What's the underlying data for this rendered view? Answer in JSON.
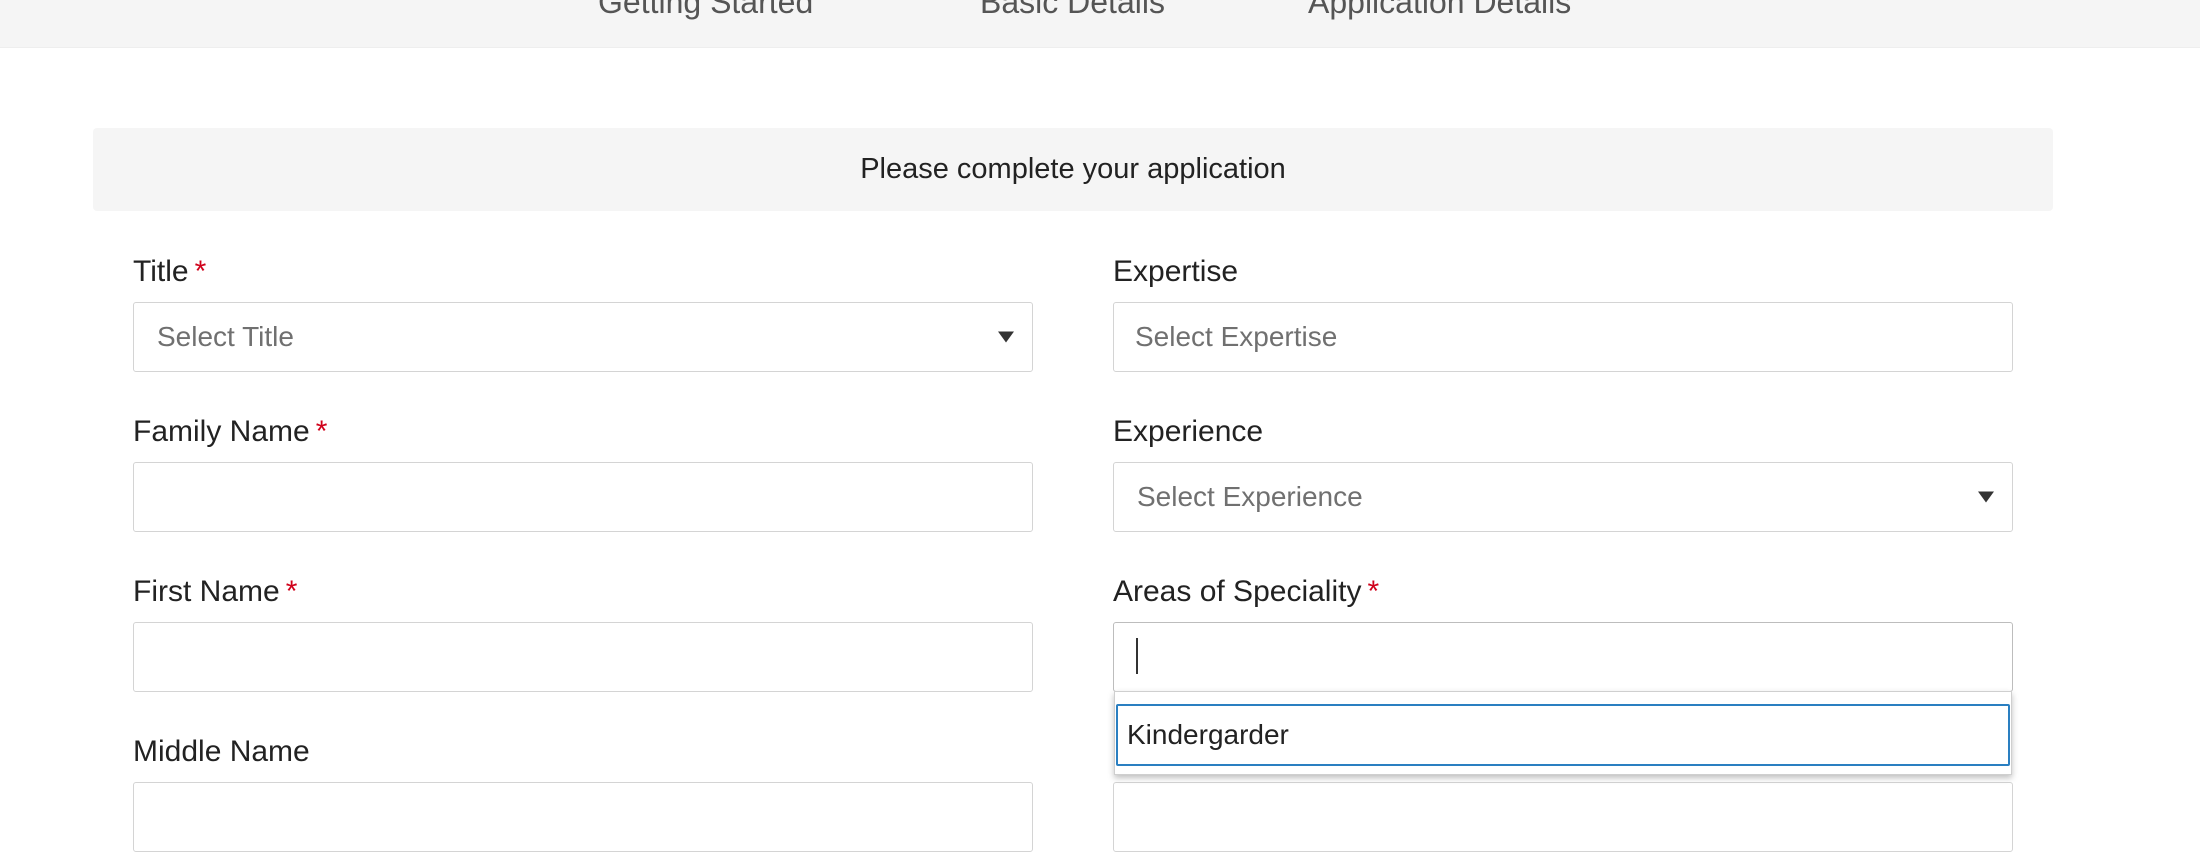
{
  "stepper": {
    "steps": [
      {
        "label": "Getting Started"
      },
      {
        "label": "Basic Details"
      },
      {
        "label": "Application Details"
      }
    ]
  },
  "banner": {
    "text": "Please complete your application"
  },
  "form": {
    "required_marker": "*",
    "title": {
      "label": "Title",
      "placeholder": "Select Title"
    },
    "family_name": {
      "label": "Family Name",
      "value": ""
    },
    "first_name": {
      "label": "First Name",
      "value": ""
    },
    "middle_name": {
      "label": "Middle Name",
      "value": ""
    },
    "expertise": {
      "label": "Expertise",
      "placeholder": "Select Expertise"
    },
    "experience": {
      "label": "Experience",
      "placeholder": "Select Experience"
    },
    "areas_of_speciality": {
      "label": "Areas of Speciality",
      "value": "",
      "options": [
        "Kindergarder"
      ]
    }
  },
  "icons": {
    "title_select": "chevron-down-icon",
    "experience_select": "chevron-down-icon"
  }
}
